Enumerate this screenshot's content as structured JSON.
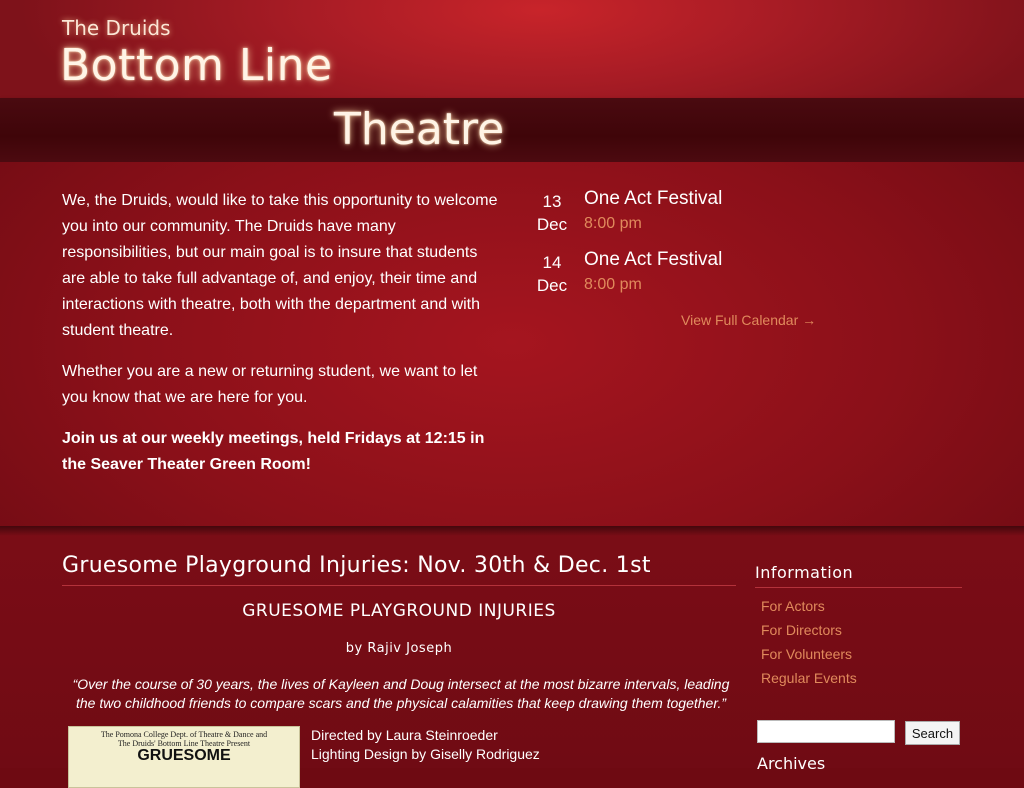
{
  "header": {
    "site_small": "The Druids",
    "site_big": "Bottom Line",
    "site_theatre": "Theatre"
  },
  "intro": {
    "p1": "We, the Druids, would like to take this opportunity to welcome you into our community. The Druids have many responsibilities, but our main goal is to insure that students are able to take full advantage of, and enjoy, their time and interactions with theatre, both with the department and with student theatre.",
    "p2": "Whether you are a new or returning student, we want to let you know that we are here for you.",
    "p3": "Join us at our weekly meetings, held Fridays at 12:15 in the Seaver Theater Green Room!"
  },
  "events": {
    "items": [
      {
        "day": "13",
        "month": "Dec",
        "title": "One Act Festival",
        "time": "8:00 pm"
      },
      {
        "day": "14",
        "month": "Dec",
        "title": "One Act Festival",
        "time": "8:00 pm"
      }
    ],
    "view_all": "View Full Calendar →"
  },
  "post": {
    "title": "Gruesome Playground Injuries: Nov. 30th & Dec. 1st",
    "subtitle": "GRUESOME PLAYGROUND INJURIES",
    "byline": "by Rajiv Joseph",
    "quote": "“Over the course of 30 years, the lives of Kayleen and Doug intersect at the most bizarre intervals, leading the two childhood friends to compare scars and the physical calamities that keep drawing them together.”",
    "poster_line1": "The Pomona College Dept. of Theatre & Dance and",
    "poster_line2": "The Druids' Bottom Line Theatre Present",
    "poster_title": "GRUESOME",
    "credits": [
      "Directed by Laura Steinroeder",
      "Lighting Design by Giselly Rodriguez"
    ]
  },
  "sidebar": {
    "info_title": "Information",
    "links": [
      "For Actors",
      "For Directors",
      "For Volunteers",
      "Regular Events"
    ],
    "search_button": "Search",
    "search_value": "",
    "archives_title": "Archives"
  },
  "colors": {
    "accent_link": "#e08a5c",
    "header_red": "#c8242a",
    "background": "#6e0a12"
  }
}
